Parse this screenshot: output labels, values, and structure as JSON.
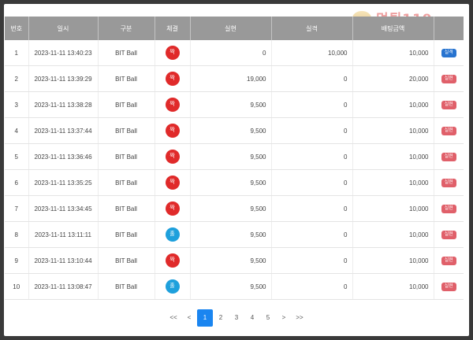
{
  "watermark": {
    "brand": "먹튀119",
    "tagline": "먹튀검증 커뮤니티 결과"
  },
  "columns": {
    "no": "번호",
    "datetime": "일시",
    "category": "구분",
    "result": "체결",
    "realized": "실현",
    "loss": "실격",
    "bet_amount": "배팅금액",
    "status": ""
  },
  "rows": [
    {
      "no": "1",
      "datetime": "2023-11-11 13:40:23",
      "category": "BIT Ball",
      "ball": "짝",
      "ball_color": "red",
      "realized": "0",
      "loss": "10,000",
      "bet": "10,000",
      "status": "실격",
      "status_type": "win"
    },
    {
      "no": "2",
      "datetime": "2023-11-11 13:39:29",
      "category": "BIT Ball",
      "ball": "짝",
      "ball_color": "red",
      "realized": "19,000",
      "loss": "0",
      "bet": "20,000",
      "status": "실현",
      "status_type": "fail"
    },
    {
      "no": "3",
      "datetime": "2023-11-11 13:38:28",
      "category": "BIT Ball",
      "ball": "짝",
      "ball_color": "red",
      "realized": "9,500",
      "loss": "0",
      "bet": "10,000",
      "status": "실현",
      "status_type": "fail"
    },
    {
      "no": "4",
      "datetime": "2023-11-11 13:37:44",
      "category": "BIT Ball",
      "ball": "짝",
      "ball_color": "red",
      "realized": "9,500",
      "loss": "0",
      "bet": "10,000",
      "status": "실현",
      "status_type": "fail"
    },
    {
      "no": "5",
      "datetime": "2023-11-11 13:36:46",
      "category": "BIT Ball",
      "ball": "짝",
      "ball_color": "red",
      "realized": "9,500",
      "loss": "0",
      "bet": "10,000",
      "status": "실현",
      "status_type": "fail"
    },
    {
      "no": "6",
      "datetime": "2023-11-11 13:35:25",
      "category": "BIT Ball",
      "ball": "짝",
      "ball_color": "red",
      "realized": "9,500",
      "loss": "0",
      "bet": "10,000",
      "status": "실현",
      "status_type": "fail"
    },
    {
      "no": "7",
      "datetime": "2023-11-11 13:34:45",
      "category": "BIT Ball",
      "ball": "짝",
      "ball_color": "red",
      "realized": "9,500",
      "loss": "0",
      "bet": "10,000",
      "status": "실현",
      "status_type": "fail"
    },
    {
      "no": "8",
      "datetime": "2023-11-11 13:11:11",
      "category": "BIT Ball",
      "ball": "홀",
      "ball_color": "blue",
      "realized": "9,500",
      "loss": "0",
      "bet": "10,000",
      "status": "실현",
      "status_type": "fail"
    },
    {
      "no": "9",
      "datetime": "2023-11-11 13:10:44",
      "category": "BIT Ball",
      "ball": "짝",
      "ball_color": "red",
      "realized": "9,500",
      "loss": "0",
      "bet": "10,000",
      "status": "실현",
      "status_type": "fail"
    },
    {
      "no": "10",
      "datetime": "2023-11-11 13:08:47",
      "category": "BIT Ball",
      "ball": "홀",
      "ball_color": "blue",
      "realized": "9,500",
      "loss": "0",
      "bet": "10,000",
      "status": "실현",
      "status_type": "fail"
    }
  ],
  "pagination": {
    "first": "<<",
    "prev": "<",
    "pages": [
      "1",
      "2",
      "3",
      "4",
      "5"
    ],
    "active_page": "1",
    "next": ">",
    "last": ">>"
  },
  "colors": {
    "page_bg": "#3a3a3a",
    "header_bg": "#999999",
    "ball_red": "#e02a2a",
    "ball_blue": "#1ea0dc",
    "badge_fail": "#e0606a",
    "badge_win": "#2874d0",
    "active_page": "#1a85f0"
  }
}
